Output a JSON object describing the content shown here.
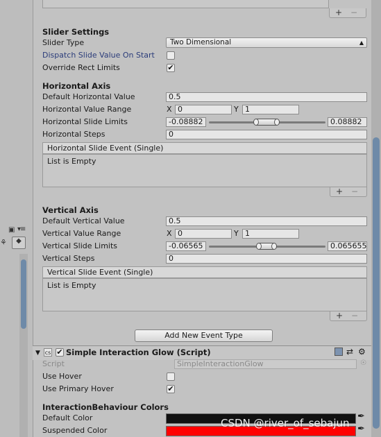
{
  "top_list": {
    "plus": "+",
    "minus": "−"
  },
  "slider_settings": {
    "heading": "Slider Settings",
    "slider_type_label": "Slider Type",
    "slider_type_value": "Two Dimensional",
    "dispatch_label": "Dispatch Slide Value On Start",
    "dispatch_checked": false,
    "override_label": "Override Rect Limits",
    "override_checked": true
  },
  "horizontal_axis": {
    "heading": "Horizontal Axis",
    "default_label": "Default Horizontal Value",
    "default_value": "0.5",
    "range_label": "Horizontal Value Range",
    "range_x_label": "X",
    "range_x": "0",
    "range_y_label": "Y",
    "range_y": "1",
    "limits_label": "Horizontal Slide Limits",
    "limit_min": "-0.08882",
    "limit_max": "0.08882",
    "steps_label": "Horizontal Steps",
    "steps_value": "0",
    "event_header": "Horizontal Slide Event (Single)",
    "event_empty": "List is Empty",
    "plus": "+",
    "minus": "−"
  },
  "vertical_axis": {
    "heading": "Vertical Axis",
    "default_label": "Default Vertical Value",
    "default_value": "0.5",
    "range_label": "Vertical Value Range",
    "range_x_label": "X",
    "range_x": "0",
    "range_y_label": "Y",
    "range_y": "1",
    "limits_label": "Vertical Slide Limits",
    "limit_min": "-0.06565",
    "limit_max": "0.065655",
    "steps_label": "Vertical Steps",
    "steps_value": "0",
    "event_header": "Vertical Slide Event (Single)",
    "event_empty": "List is Empty",
    "plus": "+",
    "minus": "−"
  },
  "add_event_button": "Add New Event Type",
  "glow_component": {
    "title": "Simple Interaction Glow (Script)",
    "enabled": true,
    "script_label": "Script",
    "script_value": "SimpleInteractionGlow",
    "use_hover_label": "Use Hover",
    "use_hover_checked": false,
    "use_primary_hover_label": "Use Primary Hover",
    "use_primary_hover_checked": true,
    "colors_heading": "InteractionBehaviour Colors",
    "default_color_label": "Default Color",
    "suspended_color_label": "Suspended Color"
  },
  "colors": {
    "default_color": "#111111",
    "suspended_color": "#ff0000",
    "accent": "#6e8aa8",
    "link_label": "#2b3c7a"
  },
  "icons": {
    "check": "✔",
    "lock": "🔒",
    "menu": "▾≡"
  },
  "watermark": "CSDN @river_of_sebajun"
}
